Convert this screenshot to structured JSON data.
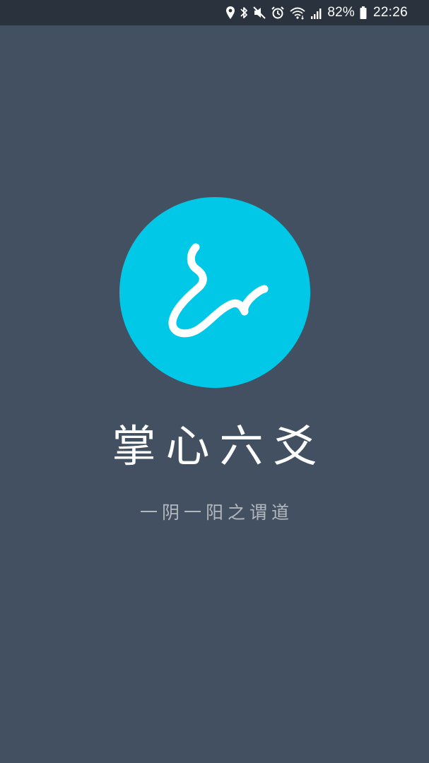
{
  "status_bar": {
    "icons": [
      "location-icon",
      "bluetooth-icon",
      "mute-icon",
      "alarm-icon",
      "wifi-icon",
      "signal-icon",
      "battery-icon"
    ],
    "battery_percent": "82%",
    "time": "22:26"
  },
  "splash": {
    "logo_icon": "app-logo-icon",
    "logo_color": "#00c8e6",
    "background_color": "#435061",
    "app_name": "掌心六爻",
    "slogan": "一阴一阳之谓道"
  }
}
